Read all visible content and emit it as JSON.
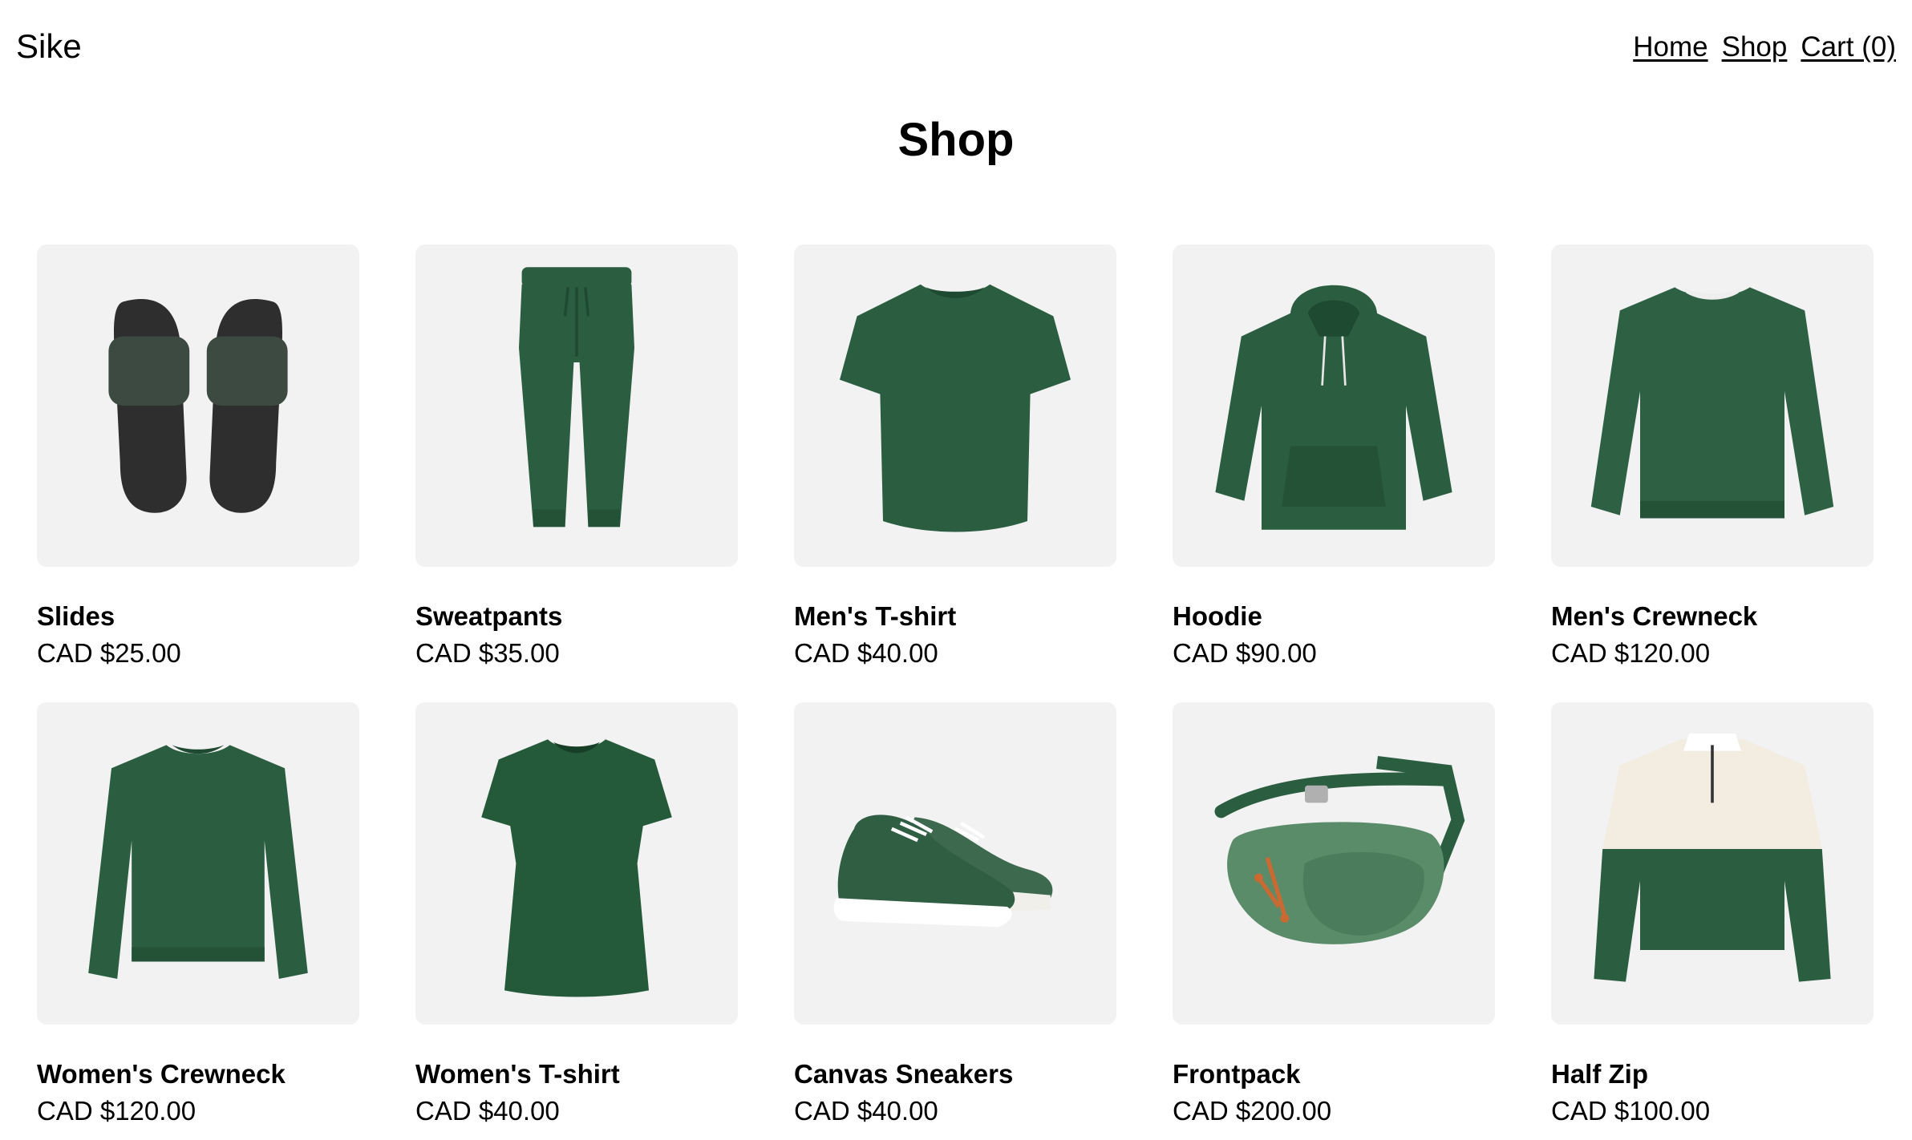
{
  "brand": "Sike",
  "nav": {
    "home": "Home",
    "shop": "Shop",
    "cart": "Cart (0)"
  },
  "page_title": "Shop",
  "colors": {
    "product_green": "#2b5e40",
    "thumb_bg": "#f2f2f2",
    "slide_black": "#2e2e2e",
    "cream": "#f3ece0"
  },
  "products": [
    {
      "name": "Slides",
      "price": "CAD $25.00",
      "icon": "slides-image"
    },
    {
      "name": "Sweatpants",
      "price": "CAD $35.00",
      "icon": "sweatpants-image"
    },
    {
      "name": "Men's T-shirt",
      "price": "CAD $40.00",
      "icon": "mens-tshirt-image"
    },
    {
      "name": "Hoodie",
      "price": "CAD $90.00",
      "icon": "hoodie-image"
    },
    {
      "name": "Men's Crewneck",
      "price": "CAD $120.00",
      "icon": "mens-crewneck-image"
    },
    {
      "name": "Women's Crewneck",
      "price": "CAD $120.00",
      "icon": "womens-crewneck-image"
    },
    {
      "name": "Women's T-shirt",
      "price": "CAD $40.00",
      "icon": "womens-tshirt-image"
    },
    {
      "name": "Canvas Sneakers",
      "price": "CAD $40.00",
      "icon": "sneakers-image"
    },
    {
      "name": "Frontpack",
      "price": "CAD $200.00",
      "icon": "frontpack-image"
    },
    {
      "name": "Half Zip",
      "price": "CAD $100.00",
      "icon": "half-zip-image"
    }
  ]
}
